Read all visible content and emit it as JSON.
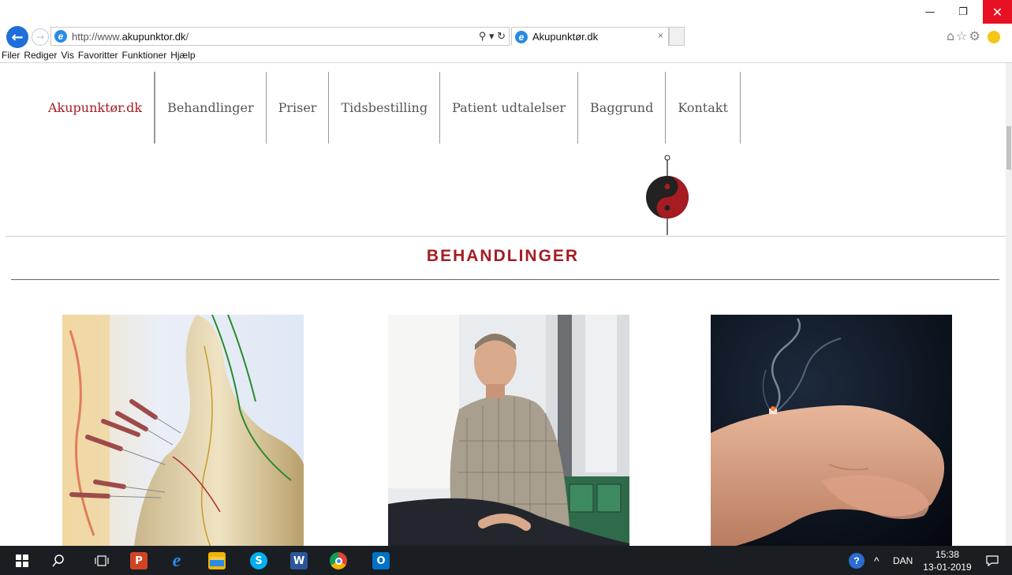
{
  "window": {
    "minimize_glyph": "—",
    "maximize_glyph": "❐",
    "close_glyph": "✕"
  },
  "browser": {
    "back_glyph": "←",
    "forward_glyph": "→",
    "url_prefix": "http://www.",
    "url_host": "akupunktor.dk",
    "url_suffix": "/",
    "address_tools": "⚲ ▾ ↻",
    "tab_title": "Akupunktør.dk",
    "tab_close_glyph": "×",
    "right_icons": "⌂☆⚙"
  },
  "menubar": [
    "Filer",
    "Rediger",
    "Vis",
    "Favoritter",
    "Funktioner",
    "Hjælp"
  ],
  "nav": {
    "items": [
      "Akupunktør.dk",
      "Behandlinger",
      "Priser",
      "Tidsbestilling",
      "Patient udtalelser",
      "Baggrund",
      "Kontakt"
    ]
  },
  "main": {
    "section_title": "BEHANDLINGER"
  },
  "taskbar": {
    "language": "DAN",
    "time": "15:38",
    "date": "13-01-2019",
    "icons": [
      "windows-start-icon",
      "search-icon",
      "task-view-icon",
      "powerpoint-icon",
      "internet-explorer-icon",
      "file-explorer-icon",
      "skype-icon",
      "word-icon",
      "chrome-icon",
      "outlook-icon"
    ]
  },
  "colors": {
    "accent": "#a51c23",
    "link_blue": "#1e6fd9",
    "taskbar": "#1a1d22",
    "close_red": "#e81123"
  }
}
